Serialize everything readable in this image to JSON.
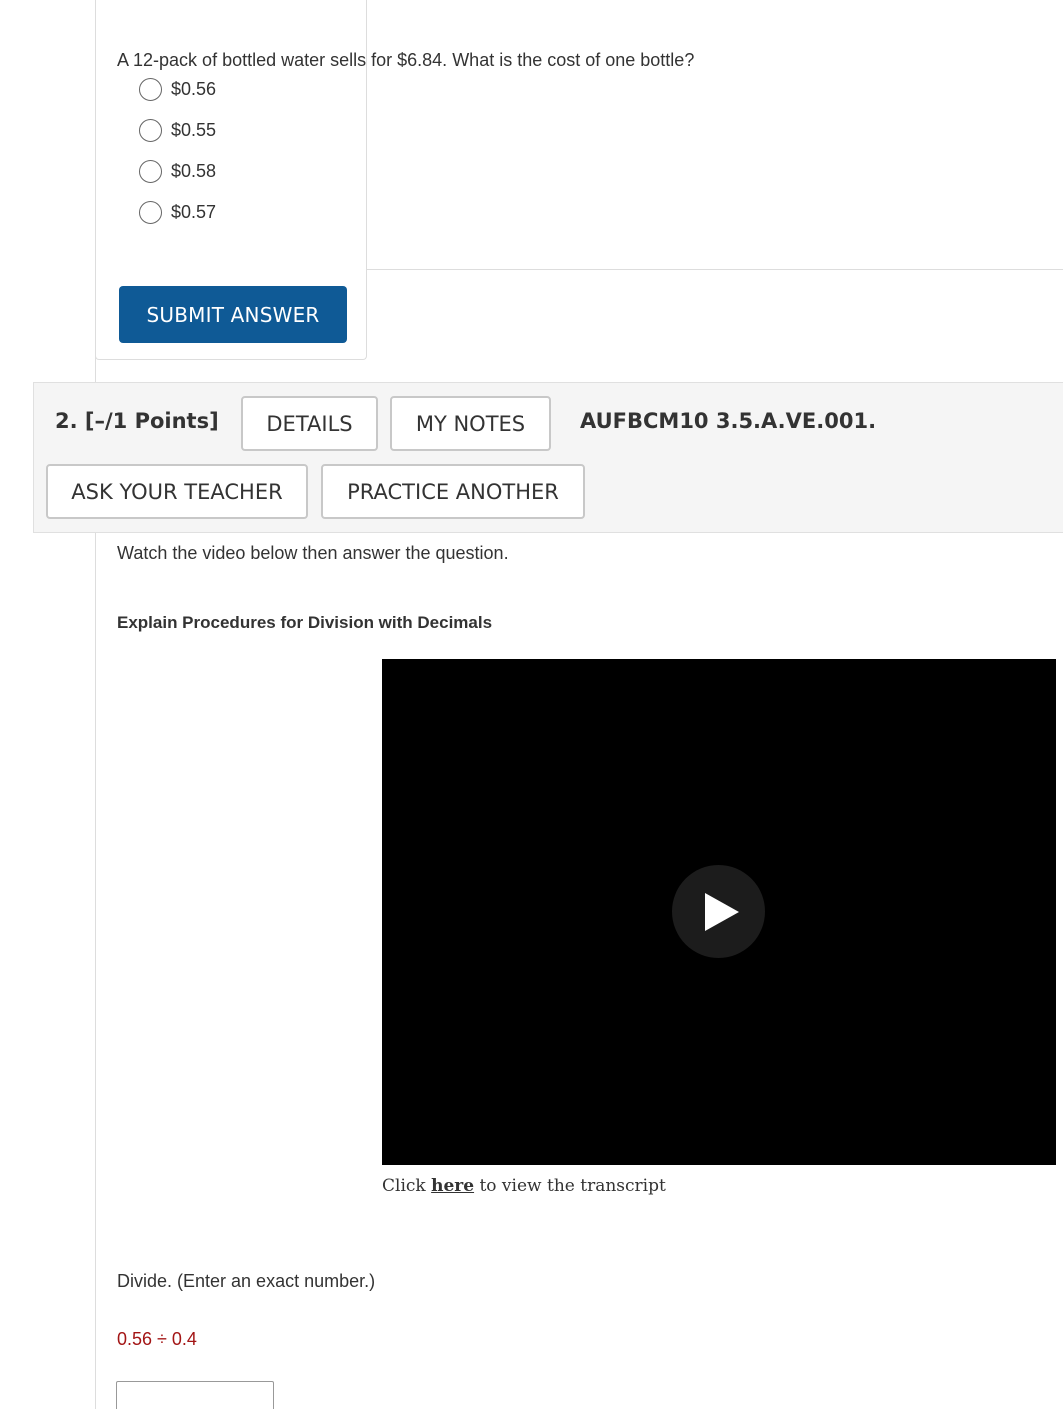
{
  "question1": {
    "prompt": "A 12-pack of bottled water sells for $6.84. What is the cost of one bottle?",
    "options": [
      "$0.56",
      "$0.55",
      "$0.58",
      "$0.57"
    ],
    "submit_label": "SUBMIT ANSWER"
  },
  "question2": {
    "number_points": "2.  [–/1 Points]",
    "details_label": "DETAILS",
    "my_notes_label": "MY NOTES",
    "code": "AUFBCM10 3.5.A.VE.001.",
    "ask_teacher_label": "ASK YOUR TEACHER",
    "practice_another_label": "PRACTICE ANOTHER",
    "instruction": "Watch the video below then answer the question.",
    "video_title": "Explain Procedures for Division with Decimals",
    "transcript": {
      "prefix": "Click ",
      "link": "here",
      "suffix": " to view the transcript"
    },
    "divide_prompt": "Divide. (Enter an exact number.)",
    "expression": "0.56 ÷ 0.4",
    "answer_value": ""
  },
  "colors": {
    "submit_button": "#0f5a96",
    "expression_text": "#a31515",
    "header_background": "#f5f5f5",
    "video_background": "#000000"
  }
}
